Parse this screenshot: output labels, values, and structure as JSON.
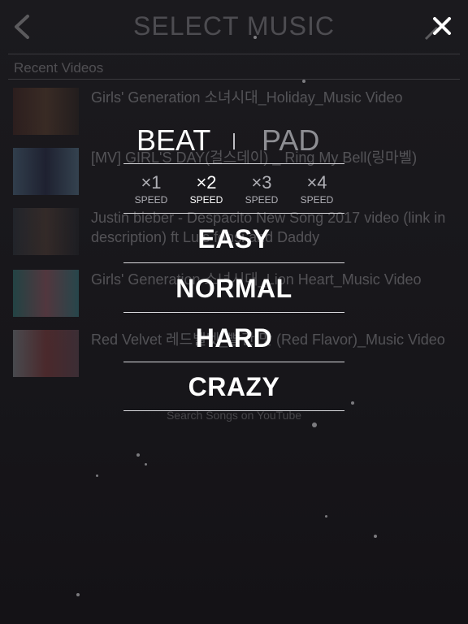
{
  "header": {
    "title": "SELECT MUSIC"
  },
  "recent": {
    "label": "Recent Videos",
    "videos": [
      {
        "title": "Girls' Generation 소녀시대_Holiday_Music Video"
      },
      {
        "title": "[MV] GIRL'S DAY(걸스데이) _ Ring My Bell(링마벨)"
      },
      {
        "title": "Justin bieber - Despacito New Song 2017 video (link in description) ft Luis fonsi and Daddy"
      },
      {
        "title": "Girls' Generation 소녀시대_Lion Heart_Music Video"
      },
      {
        "title": "Red Velvet 레드벨벳_빨간 맛 (Red Flavor)_Music Video"
      }
    ],
    "search_label": "Search Songs on YouTube"
  },
  "menu": {
    "modes": {
      "beat": "BEAT",
      "pad": "PAD",
      "selected": "BEAT"
    },
    "speeds": [
      {
        "mult": "×1",
        "label": "SPEED"
      },
      {
        "mult": "×2",
        "label": "SPEED"
      },
      {
        "mult": "×3",
        "label": "SPEED"
      },
      {
        "mult": "×4",
        "label": "SPEED"
      }
    ],
    "selected_speed": "×2",
    "difficulties": {
      "easy": "EASY",
      "normal": "NORMAL",
      "hard": "HARD",
      "crazy": "CRAZY"
    }
  },
  "icons": {
    "back": "chevron-left-icon",
    "close": "close-icon",
    "edit": "pencil-icon"
  },
  "colors": {
    "background": "#1b1a1e",
    "text": "#ffffff",
    "inactive": "#8e8e93"
  }
}
